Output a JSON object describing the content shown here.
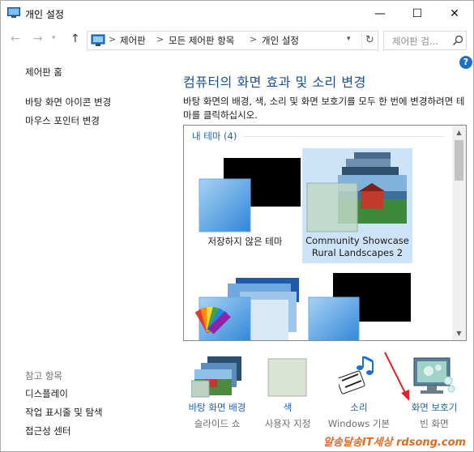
{
  "window": {
    "title": "개인 설정",
    "minimize_glyph": "—",
    "maximize_glyph": "☐",
    "close_glyph": "✕"
  },
  "nav": {
    "back_glyph": "←",
    "forward_glyph": "→",
    "recent_glyph": "▾",
    "up_glyph": "↑",
    "breadcrumb": [
      "제어판",
      "모든 제어판 항목",
      "개인 설정"
    ],
    "separator": ">",
    "dropdown_glyph": "▾",
    "refresh_glyph": "↻",
    "search_placeholder": "제어판 검..."
  },
  "help_glyph": "?",
  "sidebar": {
    "home": "제어판 홈",
    "links": [
      "바탕 화면 아이콘 변경",
      "마우스 포인터 변경"
    ],
    "see_also_header": "참고 항목",
    "see_also": [
      "디스플레이",
      "작업 표시줄 및 탐색",
      "접근성 센터"
    ]
  },
  "main": {
    "heading": "컴퓨터의 화면 효과 및 소리 변경",
    "description": "바탕 화면의 배경, 색, 소리 및 화면 보호기를 모두 한 번에 변경하려면 테마를 클릭하십시오.",
    "group_header": "내 테마 (4)",
    "themes": [
      {
        "label_lines": [
          "저장하지 않은 테마"
        ],
        "selected": false
      },
      {
        "label_lines": [
          "Community Showcase",
          "Rural Landscapes 2"
        ],
        "selected": true
      },
      {
        "label_lines": [],
        "selected": false
      },
      {
        "label_lines": [],
        "selected": false
      }
    ]
  },
  "settings": [
    {
      "name": "바탕 화면 배경",
      "value": "슬라이드 쇼",
      "icon": "desktop-background-icon"
    },
    {
      "name": "색",
      "value": "사용자 지정",
      "icon": "color-swatch-icon"
    },
    {
      "name": "소리",
      "value": "Windows 기본",
      "icon": "music-notes-icon"
    },
    {
      "name": "화면 보호기",
      "value": "빈 화면",
      "icon": "screen-saver-monitor-icon"
    }
  ],
  "colors": {
    "heading": "#1a4e9a",
    "link": "#1e60b8",
    "selection": "#cde3f7",
    "annotation_arrow": "#e0242b"
  },
  "watermark": "알송달송IT세상 rdsong.com"
}
